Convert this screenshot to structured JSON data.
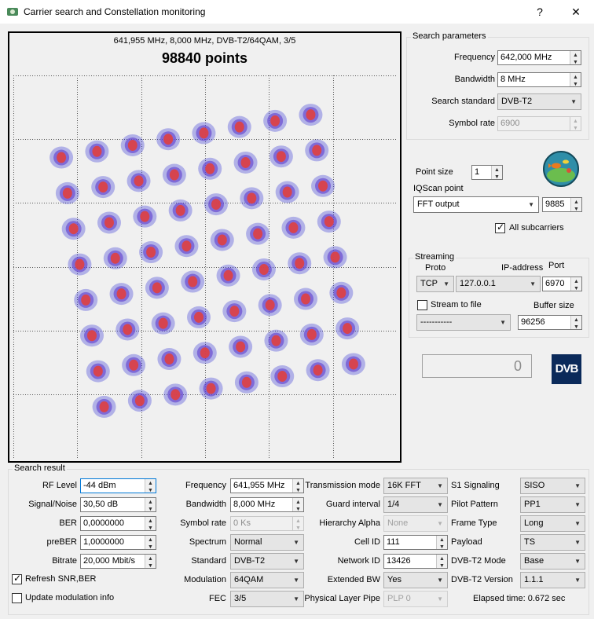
{
  "window": {
    "title": "Carrier search and Constellation monitoring",
    "help": "?",
    "close": "✕"
  },
  "plot": {
    "subtitle": "641,955 MHz, 8,000 MHz, DVB-T2/64QAM, 3/5",
    "title": "98840 points"
  },
  "search_params": {
    "legend": "Search parameters",
    "frequency_label": "Frequency",
    "frequency": "642,000 MHz",
    "bandwidth_label": "Bandwidth",
    "bandwidth": "8 MHz",
    "standard_label": "Search standard",
    "standard": "DVB-T2",
    "symbol_rate_label": "Symbol rate",
    "symbol_rate": "6900"
  },
  "point": {
    "size_label": "Point size",
    "size": "1",
    "iqscan_label": "IQScan point",
    "iqscan_value": "FFT output",
    "iqscan_index": "9885",
    "all_subcarriers_label": "All subcarriers",
    "all_subcarriers": true
  },
  "streaming": {
    "legend": "Streaming",
    "proto_label": "Proto",
    "ip_label": "IP-address",
    "port_label": "Port",
    "proto": "TCP",
    "ip": "127.0.0.1",
    "port": "6970",
    "stream_to_file_label": "Stream to file",
    "stream_to_file": false,
    "buffer_label": "Buffer size",
    "file": "-----------",
    "buffer": "96256"
  },
  "counter": {
    "value": "0"
  },
  "dvb_logo": "DVB",
  "result": {
    "legend": "Search result",
    "rf_level_label": "RF Level",
    "rf_level": "-44 dBm",
    "snr_label": "Signal/Noise",
    "snr": "30,50 dB",
    "ber_label": "BER",
    "ber": "0,0000000",
    "preber_label": "preBER",
    "preber": "1,0000000",
    "bitrate_label": "Bitrate",
    "bitrate": "20,000 Mbit/s",
    "refresh_label": "Refresh SNR,BER",
    "refresh": true,
    "update_mod_label": "Update modulation info",
    "update_mod": false,
    "frequency_label": "Frequency",
    "frequency": "641,955 MHz",
    "bandwidth_label": "Bandwidth",
    "bandwidth": "8,000 MHz",
    "symbol_rate_label": "Symbol rate",
    "symbol_rate": "0 Ks",
    "spectrum_label": "Spectrum",
    "spectrum": "Normal",
    "standard_label": "Standard",
    "standard": "DVB-T2",
    "modulation_label": "Modulation",
    "modulation": "64QAM",
    "fec_label": "FEC",
    "fec": "3/5",
    "tmode_label": "Transmission mode",
    "tmode": "16K FFT",
    "guard_label": "Guard interval",
    "guard": "1/4",
    "hier_label": "Hierarchy Alpha",
    "hier": "None",
    "cellid_label": "Cell ID",
    "cellid": "111",
    "netid_label": "Network ID",
    "netid": "13426",
    "extbw_label": "Extended BW",
    "extbw": "Yes",
    "plp_label": "Physical Layer Pipe",
    "plp": "PLP 0",
    "s1_label": "S1 Signaling",
    "s1": "SISO",
    "pilot_label": "Pilot Pattern",
    "pilot": "PP1",
    "frame_label": "Frame Type",
    "frame": "Long",
    "payload_label": "Payload",
    "payload": "TS",
    "t2mode_label": "DVB-T2 Mode",
    "t2mode": "Base",
    "t2ver_label": "DVB-T2 Version",
    "t2ver": "1.1.1",
    "elapsed": "Elapsed time: 0.672 sec"
  }
}
